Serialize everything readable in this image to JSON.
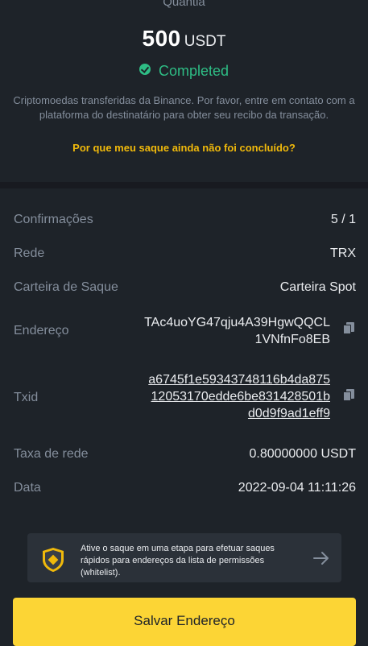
{
  "header": {
    "amount_label": "Quantia",
    "amount_value": "500",
    "amount_unit": "USDT",
    "status": "Completed",
    "description": "Criptomoedas transferidas da Binance. Por favor, entre em contato com a plataforma do destinatário para obter seu recibo da transação.",
    "help_link": "Por que meu saque ainda não foi concluído?"
  },
  "details": {
    "confirmations_label": "Confirmações",
    "confirmations_value": "5 / 1",
    "network_label": "Rede",
    "network_value": "TRX",
    "wallet_label": "Carteira de Saque",
    "wallet_value": "Carteira Spot",
    "address_label": "Endereço",
    "address_line1": "TAc4uoYG47qju4A39HgwQQCL",
    "address_line2": "1VNfnFo8EB",
    "txid_label": "Txid",
    "txid_line1": "a6745f1e59343748116b4da875",
    "txid_line2": "12053170edde6be831428501b",
    "txid_line3": "d0d9f9ad1eff9",
    "fee_label": "Taxa de rede",
    "fee_value": "0.80000000 USDT",
    "date_label": "Data",
    "date_value": "2022-09-04 11:11:26"
  },
  "banner": {
    "text": "Ative o saque em uma etapa para efetuar saques rápidos para endereços da lista de permissões (whitelist)."
  },
  "footer": {
    "save_button": "Salvar Endereço"
  },
  "colors": {
    "background": "#1e2329",
    "success": "#2ebd85",
    "accent": "#f0b90b",
    "button": "#fcd535"
  },
  "icons": [
    "check-circle-icon",
    "copy-icon",
    "shield-icon",
    "arrow-right-icon"
  ]
}
